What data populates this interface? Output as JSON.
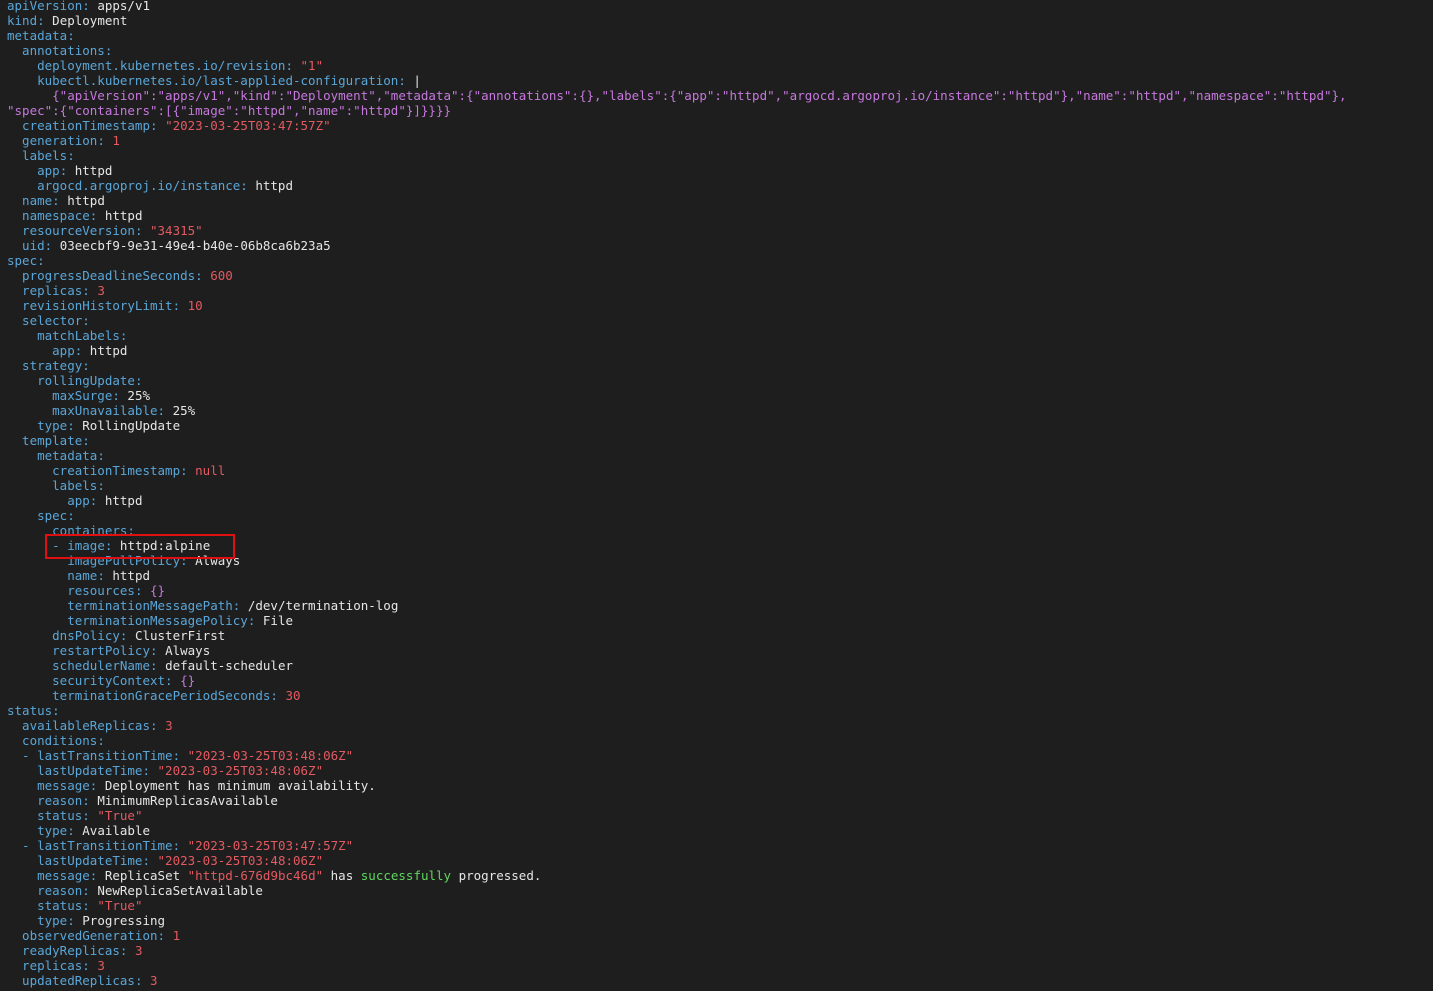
{
  "theme": {
    "background": "#1e1e1e",
    "key_color": "#5aa6d8",
    "string_color": "#e35a61",
    "value_color": "#e6e6e6",
    "success_color": "#5fd75f",
    "json_string_color": "#c678dd",
    "highlight_box_color": "#e01010"
  },
  "lines": [
    [
      {
        "t": "apiVersion",
        "c": "k"
      },
      {
        "t": ": ",
        "c": "k"
      },
      {
        "t": "apps/v1",
        "c": "v"
      }
    ],
    [
      {
        "t": "kind",
        "c": "k"
      },
      {
        "t": ": ",
        "c": "k"
      },
      {
        "t": "Deployment",
        "c": "v"
      }
    ],
    [
      {
        "t": "metadata",
        "c": "k"
      },
      {
        "t": ":",
        "c": "k"
      }
    ],
    [
      {
        "t": "  annotations",
        "c": "k"
      },
      {
        "t": ":",
        "c": "k"
      }
    ],
    [
      {
        "t": "    deployment.kubernetes.io/revision",
        "c": "k"
      },
      {
        "t": ": ",
        "c": "k"
      },
      {
        "t": "\"1\"",
        "c": "s"
      }
    ],
    [
      {
        "t": "    kubectl.kubernetes.io/last-applied-configuration",
        "c": "k"
      },
      {
        "t": ": ",
        "c": "k"
      },
      {
        "t": "|",
        "c": "v"
      }
    ],
    [
      {
        "t": "      {\"apiVersion\":\"apps/v1\",\"kind\":\"Deployment\",\"metadata\":{\"annotations\":{},\"labels\":{\"app\":\"httpd\",\"argocd.argoproj.io/instance\":\"httpd\"},\"name\":\"httpd\",\"namespace\":\"httpd\"},",
        "c": "m"
      }
    ],
    [
      {
        "t": "\"spec\":{\"containers\":[{\"image\":\"httpd\",\"name\":\"httpd\"}]}}}}",
        "c": "m"
      }
    ],
    [
      {
        "t": "  creationTimestamp",
        "c": "k"
      },
      {
        "t": ": ",
        "c": "k"
      },
      {
        "t": "\"2023-03-25T03:47:57Z\"",
        "c": "s"
      }
    ],
    [
      {
        "t": "  generation",
        "c": "k"
      },
      {
        "t": ": ",
        "c": "k"
      },
      {
        "t": "1",
        "c": "n"
      }
    ],
    [
      {
        "t": "  labels",
        "c": "k"
      },
      {
        "t": ":",
        "c": "k"
      }
    ],
    [
      {
        "t": "    app",
        "c": "k"
      },
      {
        "t": ": ",
        "c": "k"
      },
      {
        "t": "httpd",
        "c": "v"
      }
    ],
    [
      {
        "t": "    argocd.argoproj.io/instance",
        "c": "k"
      },
      {
        "t": ": ",
        "c": "k"
      },
      {
        "t": "httpd",
        "c": "v"
      }
    ],
    [
      {
        "t": "  name",
        "c": "k"
      },
      {
        "t": ": ",
        "c": "k"
      },
      {
        "t": "httpd",
        "c": "v"
      }
    ],
    [
      {
        "t": "  namespace",
        "c": "k"
      },
      {
        "t": ": ",
        "c": "k"
      },
      {
        "t": "httpd",
        "c": "v"
      }
    ],
    [
      {
        "t": "  resourceVersion",
        "c": "k"
      },
      {
        "t": ": ",
        "c": "k"
      },
      {
        "t": "\"34315\"",
        "c": "s"
      }
    ],
    [
      {
        "t": "  uid",
        "c": "k"
      },
      {
        "t": ": ",
        "c": "k"
      },
      {
        "t": "03eecbf9-9e31-49e4-b40e-06b8ca6b23a5",
        "c": "v"
      }
    ],
    [
      {
        "t": "spec",
        "c": "k"
      },
      {
        "t": ":",
        "c": "k"
      }
    ],
    [
      {
        "t": "  progressDeadlineSeconds",
        "c": "k"
      },
      {
        "t": ": ",
        "c": "k"
      },
      {
        "t": "600",
        "c": "n"
      }
    ],
    [
      {
        "t": "  replicas",
        "c": "k"
      },
      {
        "t": ": ",
        "c": "k"
      },
      {
        "t": "3",
        "c": "n"
      }
    ],
    [
      {
        "t": "  revisionHistoryLimit",
        "c": "k"
      },
      {
        "t": ": ",
        "c": "k"
      },
      {
        "t": "10",
        "c": "n"
      }
    ],
    [
      {
        "t": "  selector",
        "c": "k"
      },
      {
        "t": ":",
        "c": "k"
      }
    ],
    [
      {
        "t": "    matchLabels",
        "c": "k"
      },
      {
        "t": ":",
        "c": "k"
      }
    ],
    [
      {
        "t": "      app",
        "c": "k"
      },
      {
        "t": ": ",
        "c": "k"
      },
      {
        "t": "httpd",
        "c": "v"
      }
    ],
    [
      {
        "t": "  strategy",
        "c": "k"
      },
      {
        "t": ":",
        "c": "k"
      }
    ],
    [
      {
        "t": "    rollingUpdate",
        "c": "k"
      },
      {
        "t": ":",
        "c": "k"
      }
    ],
    [
      {
        "t": "      maxSurge",
        "c": "k"
      },
      {
        "t": ": ",
        "c": "k"
      },
      {
        "t": "25%",
        "c": "v"
      }
    ],
    [
      {
        "t": "      maxUnavailable",
        "c": "k"
      },
      {
        "t": ": ",
        "c": "k"
      },
      {
        "t": "25%",
        "c": "v"
      }
    ],
    [
      {
        "t": "    type",
        "c": "k"
      },
      {
        "t": ": ",
        "c": "k"
      },
      {
        "t": "RollingUpdate",
        "c": "v"
      }
    ],
    [
      {
        "t": "  template",
        "c": "k"
      },
      {
        "t": ":",
        "c": "k"
      }
    ],
    [
      {
        "t": "    metadata",
        "c": "k"
      },
      {
        "t": ":",
        "c": "k"
      }
    ],
    [
      {
        "t": "      creationTimestamp",
        "c": "k"
      },
      {
        "t": ": ",
        "c": "k"
      },
      {
        "t": "null",
        "c": "n"
      }
    ],
    [
      {
        "t": "      labels",
        "c": "k"
      },
      {
        "t": ":",
        "c": "k"
      }
    ],
    [
      {
        "t": "        app",
        "c": "k"
      },
      {
        "t": ": ",
        "c": "k"
      },
      {
        "t": "httpd",
        "c": "v"
      }
    ],
    [
      {
        "t": "    spec",
        "c": "k"
      },
      {
        "t": ":",
        "c": "k"
      }
    ],
    [
      {
        "t": "      containers",
        "c": "k"
      },
      {
        "t": ":",
        "c": "k"
      }
    ],
    [
      {
        "t": "      - ",
        "c": "k"
      },
      {
        "t": "image",
        "c": "k"
      },
      {
        "t": ": ",
        "c": "k"
      },
      {
        "t": "httpd:alpine",
        "c": "v"
      }
    ],
    [
      {
        "t": "        imagePullPolicy",
        "c": "k"
      },
      {
        "t": ": ",
        "c": "k"
      },
      {
        "t": "Always",
        "c": "v"
      }
    ],
    [
      {
        "t": "        name",
        "c": "k"
      },
      {
        "t": ": ",
        "c": "k"
      },
      {
        "t": "httpd",
        "c": "v"
      }
    ],
    [
      {
        "t": "        resources",
        "c": "k"
      },
      {
        "t": ": ",
        "c": "k"
      },
      {
        "t": "{}",
        "c": "m"
      }
    ],
    [
      {
        "t": "        terminationMessagePath",
        "c": "k"
      },
      {
        "t": ": ",
        "c": "k"
      },
      {
        "t": "/dev/termination-log",
        "c": "v"
      }
    ],
    [
      {
        "t": "        terminationMessagePolicy",
        "c": "k"
      },
      {
        "t": ": ",
        "c": "k"
      },
      {
        "t": "File",
        "c": "v"
      }
    ],
    [
      {
        "t": "      dnsPolicy",
        "c": "k"
      },
      {
        "t": ": ",
        "c": "k"
      },
      {
        "t": "ClusterFirst",
        "c": "v"
      }
    ],
    [
      {
        "t": "      restartPolicy",
        "c": "k"
      },
      {
        "t": ": ",
        "c": "k"
      },
      {
        "t": "Always",
        "c": "v"
      }
    ],
    [
      {
        "t": "      schedulerName",
        "c": "k"
      },
      {
        "t": ": ",
        "c": "k"
      },
      {
        "t": "default-scheduler",
        "c": "v"
      }
    ],
    [
      {
        "t": "      securityContext",
        "c": "k"
      },
      {
        "t": ": ",
        "c": "k"
      },
      {
        "t": "{}",
        "c": "m"
      }
    ],
    [
      {
        "t": "      terminationGracePeriodSeconds",
        "c": "k"
      },
      {
        "t": ": ",
        "c": "k"
      },
      {
        "t": "30",
        "c": "n"
      }
    ],
    [
      {
        "t": "status",
        "c": "k"
      },
      {
        "t": ":",
        "c": "k"
      }
    ],
    [
      {
        "t": "  availableReplicas",
        "c": "k"
      },
      {
        "t": ": ",
        "c": "k"
      },
      {
        "t": "3",
        "c": "n"
      }
    ],
    [
      {
        "t": "  conditions",
        "c": "k"
      },
      {
        "t": ":",
        "c": "k"
      }
    ],
    [
      {
        "t": "  - ",
        "c": "k"
      },
      {
        "t": "lastTransitionTime",
        "c": "k"
      },
      {
        "t": ": ",
        "c": "k"
      },
      {
        "t": "\"2023-03-25T03:48:06Z\"",
        "c": "s"
      }
    ],
    [
      {
        "t": "    lastUpdateTime",
        "c": "k"
      },
      {
        "t": ": ",
        "c": "k"
      },
      {
        "t": "\"2023-03-25T03:48:06Z\"",
        "c": "s"
      }
    ],
    [
      {
        "t": "    message",
        "c": "k"
      },
      {
        "t": ": ",
        "c": "k"
      },
      {
        "t": "Deployment has minimum availability.",
        "c": "v"
      }
    ],
    [
      {
        "t": "    reason",
        "c": "k"
      },
      {
        "t": ": ",
        "c": "k"
      },
      {
        "t": "MinimumReplicasAvailable",
        "c": "v"
      }
    ],
    [
      {
        "t": "    status",
        "c": "k"
      },
      {
        "t": ": ",
        "c": "k"
      },
      {
        "t": "\"True\"",
        "c": "s"
      }
    ],
    [
      {
        "t": "    type",
        "c": "k"
      },
      {
        "t": ": ",
        "c": "k"
      },
      {
        "t": "Available",
        "c": "v"
      }
    ],
    [
      {
        "t": "  - ",
        "c": "k"
      },
      {
        "t": "lastTransitionTime",
        "c": "k"
      },
      {
        "t": ": ",
        "c": "k"
      },
      {
        "t": "\"2023-03-25T03:47:57Z\"",
        "c": "s"
      }
    ],
    [
      {
        "t": "    lastUpdateTime",
        "c": "k"
      },
      {
        "t": ": ",
        "c": "k"
      },
      {
        "t": "\"2023-03-25T03:48:06Z\"",
        "c": "s"
      }
    ],
    [
      {
        "t": "    message",
        "c": "k"
      },
      {
        "t": ": ",
        "c": "k"
      },
      {
        "t": "ReplicaSet ",
        "c": "v"
      },
      {
        "t": "\"httpd-676d9bc46d\"",
        "c": "s"
      },
      {
        "t": " has ",
        "c": "v"
      },
      {
        "t": "successfully",
        "c": "g"
      },
      {
        "t": " progressed.",
        "c": "v"
      }
    ],
    [
      {
        "t": "    reason",
        "c": "k"
      },
      {
        "t": ": ",
        "c": "k"
      },
      {
        "t": "NewReplicaSetAvailable",
        "c": "v"
      }
    ],
    [
      {
        "t": "    status",
        "c": "k"
      },
      {
        "t": ": ",
        "c": "k"
      },
      {
        "t": "\"True\"",
        "c": "s"
      }
    ],
    [
      {
        "t": "    type",
        "c": "k"
      },
      {
        "t": ": ",
        "c": "k"
      },
      {
        "t": "Progressing",
        "c": "v"
      }
    ],
    [
      {
        "t": "  observedGeneration",
        "c": "k"
      },
      {
        "t": ": ",
        "c": "k"
      },
      {
        "t": "1",
        "c": "n"
      }
    ],
    [
      {
        "t": "  readyReplicas",
        "c": "k"
      },
      {
        "t": ": ",
        "c": "k"
      },
      {
        "t": "3",
        "c": "n"
      }
    ],
    [
      {
        "t": "  replicas",
        "c": "k"
      },
      {
        "t": ": ",
        "c": "k"
      },
      {
        "t": "3",
        "c": "n"
      }
    ],
    [
      {
        "t": "  updatedReplicas",
        "c": "k"
      },
      {
        "t": ": ",
        "c": "k"
      },
      {
        "t": "3",
        "c": "n"
      }
    ]
  ]
}
